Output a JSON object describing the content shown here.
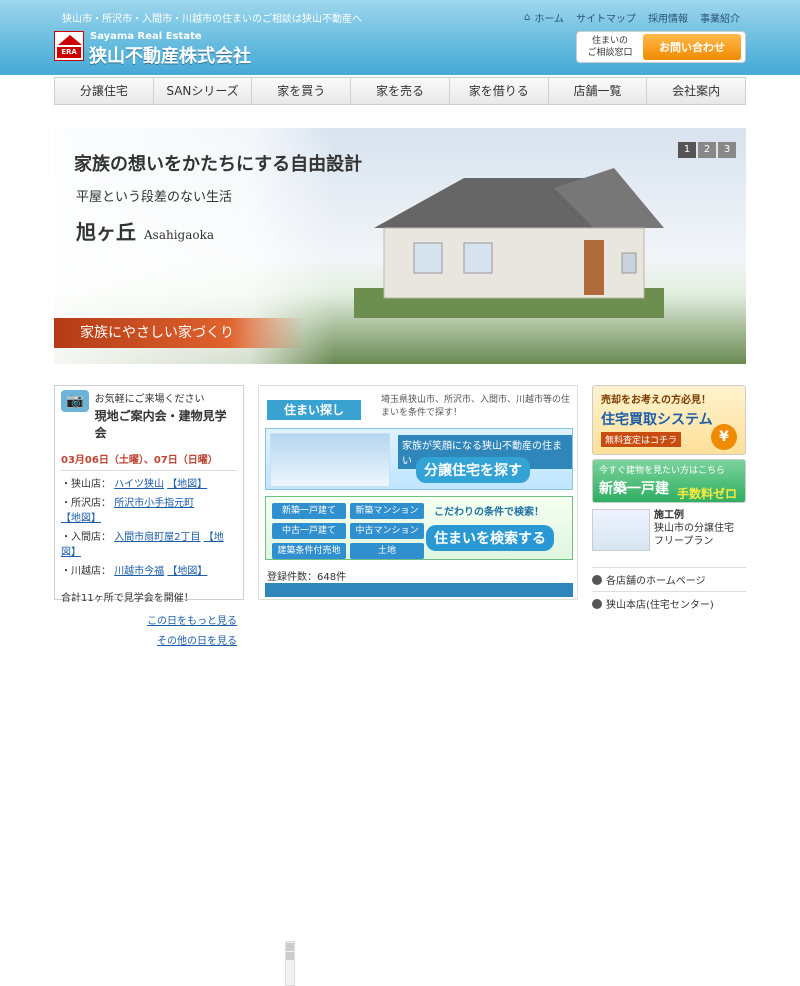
{
  "header": {
    "tagline": "狭山市・所沢市・入間市・川越市の住まいのご相談は狭山不動産へ",
    "top_links": [
      {
        "icon": "home-icon",
        "label": "ホーム"
      },
      {
        "label": "サイトマップ"
      },
      {
        "label": "採用情報"
      },
      {
        "label": "事業紹介"
      }
    ],
    "brand_en": "Sayama Real Estate",
    "brand_jp": "狭山不動産株式会社",
    "logo_text": "ERA",
    "consult_text": "住まいの\nご相談窓口",
    "contact_button": "お問い合わせ"
  },
  "nav": {
    "items": [
      "分譲住宅",
      "SANシリーズ",
      "家を買う",
      "家を売る",
      "家を借りる",
      "店舗一覧",
      "会社案内"
    ]
  },
  "hero": {
    "headline": "家族の想いをかたちにする自由設計",
    "sub": "平屋という段差のない生活",
    "place_jp": "旭ヶ丘",
    "place_en": "Asahigaoka",
    "banner": "家族にやさしい家づくり",
    "pager": [
      "1",
      "2",
      "3"
    ]
  },
  "visit": {
    "small": "お気軽にご来場ください",
    "title": "現地ご案内会・建物見学会",
    "date": "03月06日（土曜）、07日（日曜）",
    "rows": [
      {
        "store": "・狭山店：",
        "link": "ハイツ狭山",
        "suffix": "【地図】"
      },
      {
        "store": "・所沢店：",
        "link": "所沢市小手指元町",
        "suffix": "【地図】"
      },
      {
        "store": "・入間店：",
        "link": "入間市扇町屋2丁目",
        "suffix": "【地図】"
      },
      {
        "store": "・川越店：",
        "link": "川越市今福",
        "suffix": "【地図】"
      }
    ],
    "total": "合計11ヶ所で見学会を開催！",
    "more1": "この日をもっと見る",
    "more2": "その他の日を見る"
  },
  "search": {
    "tag": "住まい探し",
    "desc": "埼玉県狭山市、所沢市、入間市、川越市等の住まいを条件で探す！",
    "card1_note": "家族が笑顔になる狭山不動産の住まい",
    "card1_btn": "分譲住宅を探す",
    "grid": [
      "新築一戸建て",
      "新築マンション",
      "中古一戸建て",
      "中古マンション",
      "建築条件付売地",
      "土地"
    ],
    "card2_note": "こだわりの条件で検索！",
    "card2_btn": "住まいを検索する",
    "count_label": "登録件数：",
    "count_value": "648件"
  },
  "right": {
    "ad1_top": "売却をお考えの方必見！",
    "ad1_title": "住宅買取システム",
    "ad1_note": "無料査定はコチラ",
    "ad1_icon": "yen-icon",
    "ad2_top": "今すぐ建物を見たい方はこちら",
    "ad2_title": "新築一戸建",
    "ad2_badge": "手数料ゼロ",
    "example_title": "施工例",
    "example_desc": "狭山市の分譲住宅\nフリープラン",
    "links": [
      {
        "label": "各店舗のホームページ"
      },
      {
        "label": "狭山本店(住宅センター)"
      }
    ]
  }
}
